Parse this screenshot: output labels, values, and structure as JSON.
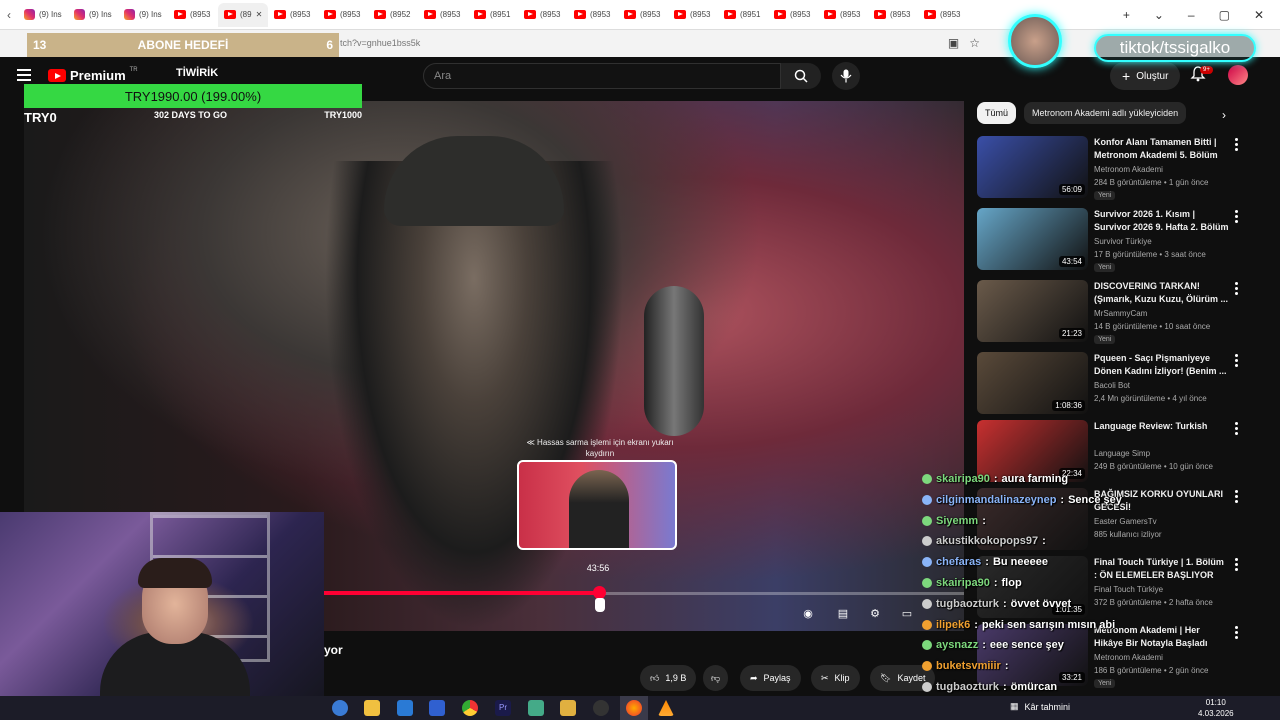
{
  "browser": {
    "tabs": [
      {
        "label": "(9) Ins",
        "type": "ig"
      },
      {
        "label": "(9) Ins",
        "type": "ig"
      },
      {
        "label": "(9) Ins",
        "type": "ig"
      },
      {
        "label": "(8953",
        "type": "yt"
      },
      {
        "label": "(89",
        "type": "yt",
        "active": true
      },
      {
        "label": "(8953",
        "type": "yt"
      },
      {
        "label": "(8953",
        "type": "yt"
      },
      {
        "label": "(8952",
        "type": "yt"
      },
      {
        "label": "(8953",
        "type": "yt"
      },
      {
        "label": "(8951",
        "type": "yt"
      },
      {
        "label": "(8953",
        "type": "yt"
      },
      {
        "label": "(8953",
        "type": "yt"
      },
      {
        "label": "(8953",
        "type": "yt"
      },
      {
        "label": "(8953",
        "type": "yt"
      },
      {
        "label": "(8951",
        "type": "yt"
      },
      {
        "label": "(8953",
        "type": "yt"
      },
      {
        "label": "(8953",
        "type": "yt"
      },
      {
        "label": "(8953",
        "type": "yt"
      },
      {
        "label": "(8953",
        "type": "yt"
      }
    ],
    "url": "tch?v=gnhue1bss5k"
  },
  "abone": {
    "left": "13",
    "title": "ABONE HEDEFİ",
    "right": "6"
  },
  "youtube": {
    "brand": "Premium",
    "region": "TR",
    "search_placeholder": "Ara",
    "create_label": "Oluştur",
    "notif_count": "9+"
  },
  "donation": {
    "site": "TİWİRİK",
    "amount": "TRY1990.00 (199.00%)",
    "start": "TRY0",
    "days": "302 DAYS TO GO",
    "goal": "TRY1000",
    "progress_fraction": 1.0
  },
  "player": {
    "scrub_hint": "≪ Hassas sarma işlemi için ekranı yukarı kaydırın",
    "preview_time": "43:56",
    "progress_fraction": 0.43,
    "title_fragment": "yor"
  },
  "actions": {
    "likes": "1,9 B",
    "share": "Paylaş",
    "clip": "Klip",
    "save": "Kaydet"
  },
  "chips": [
    "Tümü",
    "Metronom Akademi adlı yükleyiciden"
  ],
  "recommendations": [
    {
      "title": "Konfor Alanı Tamamen Bitti | Metronom Akademi 5. Bölüm",
      "channel": "Metronom Akademi",
      "stats": "284 B görüntüleme • 1 gün önce",
      "badge": "Yeni",
      "duration": "56:09",
      "thumb_color": "#3a4fa8"
    },
    {
      "title": "Survivor 2026 1. Kısım | Survivor 2026 9. Hafta 2. Bölüm",
      "channel": "Survivor Türkiye",
      "stats": "17 B görüntüleme • 3 saat önce",
      "badge": "Yeni",
      "duration": "43:54",
      "thumb_color": "#66a6c8"
    },
    {
      "title": "DISCOVERING TARKAN! (Şımarık, Kuzu Kuzu, Ölürüm ...",
      "channel": "MrSammyCam",
      "stats": "14 B görüntüleme • 10 saat önce",
      "badge": "Yeni",
      "duration": "21:23",
      "thumb_color": "#6a5a4a"
    },
    {
      "title": "Pqueen - Saçı Pişmaniyeye Dönen Kadını İzliyor! (Benim ...",
      "channel": "Bacoli Bot",
      "stats": "2,4 Mn görüntüleme • 4 yıl önce",
      "badge": "",
      "duration": "1:08:36",
      "thumb_color": "#5a4a3a"
    },
    {
      "title": "Language Review: Turkish",
      "channel": "Language Simp",
      "stats": "249 B görüntüleme • 10 gün önce",
      "badge": "",
      "duration": "22:34",
      "thumb_color": "#c83030"
    },
    {
      "title": "BAĞIMSIZ KORKU OYUNLARI GECESİ!",
      "channel": "Easter GamersTv",
      "stats": "885 kullanıcı izliyor",
      "badge": "",
      "duration": "",
      "thumb_color": "#3a2a2a"
    },
    {
      "title": "Final Touch Türkiye | 1. Bölüm : ÖN ELEMELER BAŞLIYOR",
      "channel": "Final Touch Türkiye",
      "stats": "372 B görüntüleme • 2 hafta önce",
      "badge": "",
      "duration": "1:01:35",
      "thumb_color": "#2a2a2a"
    },
    {
      "title": "Metronom Akademi | Her Hikâye Bir Notayla Başladı",
      "channel": "Metronom Akademi",
      "stats": "186 B görüntüleme • 2 gün önce",
      "badge": "Yeni",
      "duration": "33:21",
      "thumb_color": "#4a3a6a"
    }
  ],
  "chat": [
    {
      "user": "skairipa90",
      "msg": "aura farming",
      "color": "#7dd87d"
    },
    {
      "user": "cilginmandalinazeynep",
      "msg": "Sence şey",
      "color": "#8ab4f8"
    },
    {
      "user": "Siyemm",
      "msg": "",
      "color": "#7dd87d"
    },
    {
      "user": "akustikkokopops97",
      "msg": "",
      "color": "#cccccc"
    },
    {
      "user": "chefaras",
      "msg": "Bu neeeee",
      "color": "#8ab4f8"
    },
    {
      "user": "skairipa90",
      "msg": "flop",
      "color": "#7dd87d"
    },
    {
      "user": "tugbaozturk",
      "msg": "övvet övvet",
      "color": "#cccccc"
    },
    {
      "user": "ilipek6",
      "msg": "peki sen sarışın mısın abi",
      "color": "#f0a030"
    },
    {
      "user": "aysnazz",
      "msg": "eee sence şey",
      "color": "#7dd87d"
    },
    {
      "user": "buketsvmiiir",
      "msg": "",
      "color": "#f0a030"
    },
    {
      "user": "tugbaozturk",
      "msg": "ömürcan",
      "color": "#cccccc"
    }
  ],
  "streamer": {
    "tiktok": "tiktok/tssigalko"
  },
  "taskbar": {
    "weather": "Kâr tahmini",
    "time": "01:10",
    "date": "4.03.2026"
  },
  "colors": {
    "accent": "#ff0033",
    "youtube_red": "#ff0000",
    "goal_green": "#35d843",
    "tiktok_glow": "#33ffff"
  }
}
